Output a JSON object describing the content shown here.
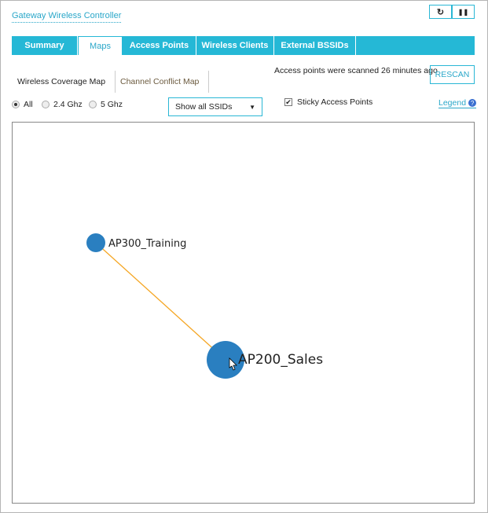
{
  "header": {
    "title": "Gateway Wireless Controller",
    "refresh_icon": "↻",
    "pause_icon": "❚❚"
  },
  "tabs": [
    {
      "label": "Summary"
    },
    {
      "label": "Maps",
      "active": true
    },
    {
      "label": "Access Points"
    },
    {
      "label": "Wireless Clients"
    },
    {
      "label": "External BSSIDs"
    }
  ],
  "subtabs": [
    {
      "label": "Wireless Coverage Map",
      "active": true
    },
    {
      "label": "Channel Conflict Map"
    }
  ],
  "scan_status": "Access points were scanned 26 minutes ago",
  "rescan_label": "RESCAN",
  "bands": [
    {
      "label": "All",
      "selected": true
    },
    {
      "label": "2.4 Ghz"
    },
    {
      "label": "5 Ghz"
    }
  ],
  "ssid_select": {
    "value": "Show all SSIDs"
  },
  "sticky": {
    "label": "Sticky Access Points",
    "checked": true
  },
  "legend_label": "Legend",
  "map": {
    "nodes": [
      {
        "name": "AP300_Training"
      },
      {
        "name": "AP200_Sales"
      }
    ],
    "link_color": "#f5a623",
    "node_color": "#2a7fc0"
  }
}
